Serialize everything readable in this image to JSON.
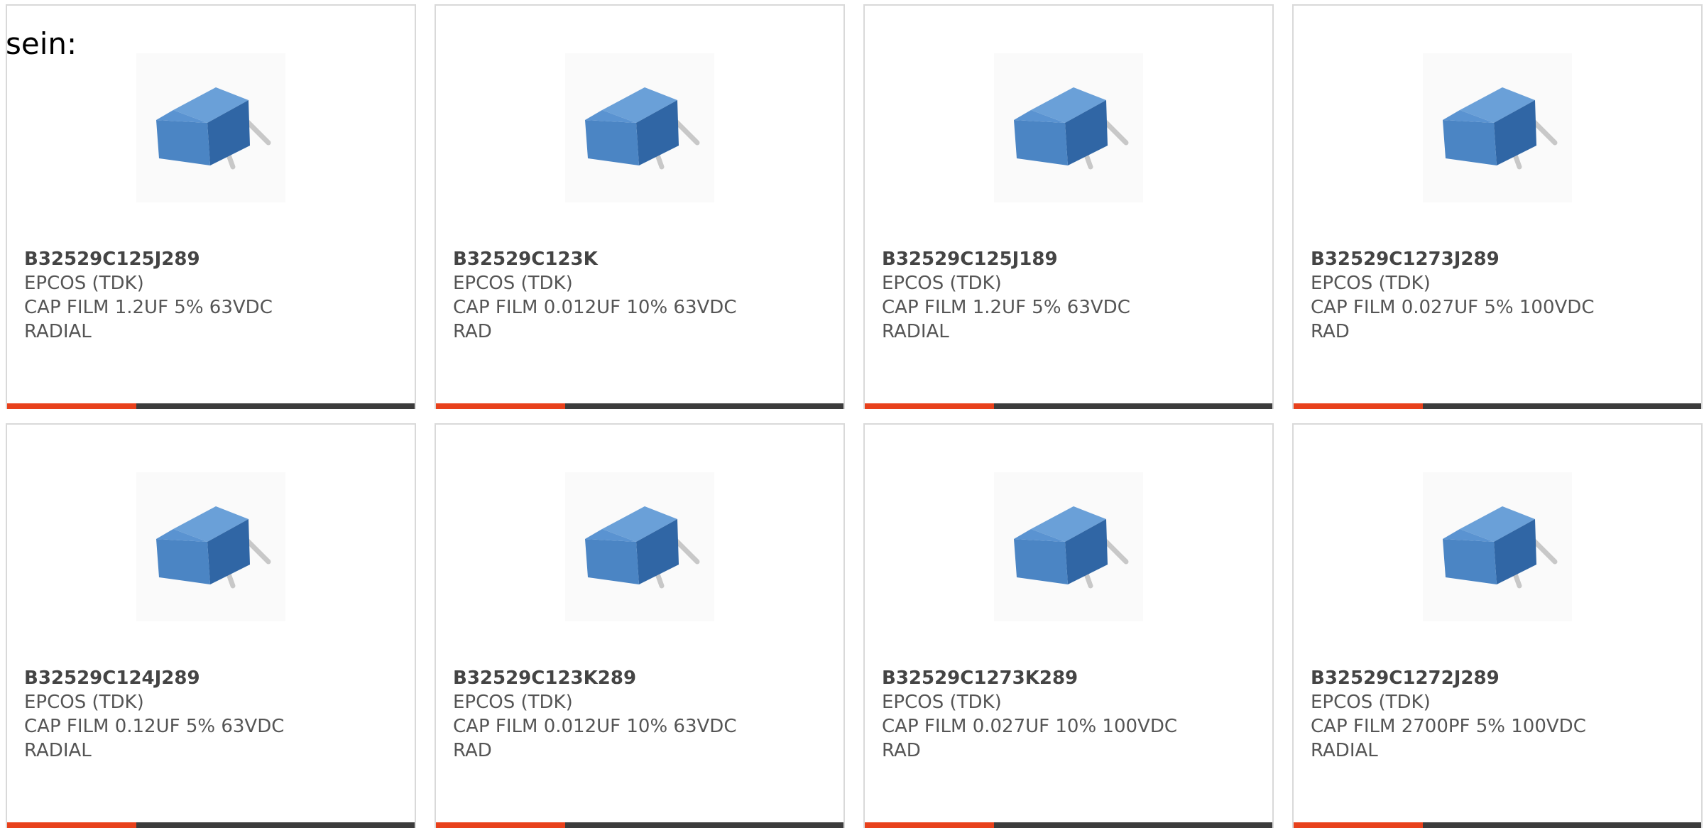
{
  "intro_text": "sein:",
  "colors": {
    "accent": "#e8411c",
    "bar": "#3c3c3c",
    "capacitor_body": "#3e78b7",
    "border": "#d9d9d9"
  },
  "image_icon": "film-capacitor-image",
  "products": [
    {
      "part_number": "B32529C125J289",
      "manufacturer": "EPCOS (TDK)",
      "description_line1": "CAP FILM 1.2UF 5% 63VDC",
      "description_line2": "RADIAL"
    },
    {
      "part_number": "B32529C123K",
      "manufacturer": "EPCOS (TDK)",
      "description_line1": "CAP FILM 0.012UF 10% 63VDC",
      "description_line2": "RAD"
    },
    {
      "part_number": "B32529C125J189",
      "manufacturer": "EPCOS (TDK)",
      "description_line1": "CAP FILM 1.2UF 5% 63VDC",
      "description_line2": "RADIAL"
    },
    {
      "part_number": "B32529C1273J289",
      "manufacturer": "EPCOS (TDK)",
      "description_line1": "CAP FILM 0.027UF 5% 100VDC",
      "description_line2": "RAD"
    },
    {
      "part_number": "B32529C124J289",
      "manufacturer": "EPCOS (TDK)",
      "description_line1": "CAP FILM 0.12UF 5% 63VDC",
      "description_line2": "RADIAL"
    },
    {
      "part_number": "B32529C123K289",
      "manufacturer": "EPCOS (TDK)",
      "description_line1": "CAP FILM 0.012UF 10% 63VDC",
      "description_line2": "RAD"
    },
    {
      "part_number": "B32529C1273K289",
      "manufacturer": "EPCOS (TDK)",
      "description_line1": "CAP FILM 0.027UF 10% 100VDC",
      "description_line2": "RAD"
    },
    {
      "part_number": "B32529C1272J289",
      "manufacturer": "EPCOS (TDK)",
      "description_line1": "CAP FILM 2700PF 5% 100VDC",
      "description_line2": "RADIAL"
    }
  ]
}
